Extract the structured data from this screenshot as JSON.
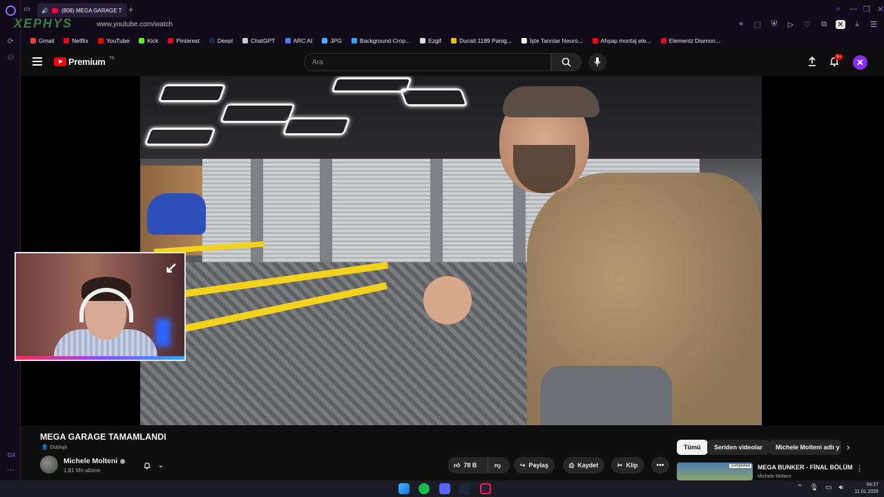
{
  "browser": {
    "tab_title": "(808) MEGA GARAGE T",
    "url": "www.youtube.com/watch",
    "brand_text": "XEPHYS",
    "gx_label": "GX",
    "bookmarks": [
      {
        "label": "Gmail",
        "color": "#ea4335"
      },
      {
        "label": "Netflix",
        "color": "#e50914"
      },
      {
        "label": "YouTube",
        "color": "#ff0000"
      },
      {
        "label": "Kick",
        "color": "#53fc18"
      },
      {
        "label": "Pinterest",
        "color": "#e60023"
      },
      {
        "label": "Deepl",
        "color": "#0f2b46"
      },
      {
        "label": "ChatGPT",
        "color": "#cccccc"
      },
      {
        "label": "ARC AI",
        "color": "#4f7cff"
      },
      {
        "label": "JPG",
        "color": "#4ab0ff"
      },
      {
        "label": "Background Crop...",
        "color": "#2fa6ff"
      },
      {
        "label": "Ezgif",
        "color": "#dddddd"
      },
      {
        "label": "Ducati 1199 Panig...",
        "color": "#e8c300"
      },
      {
        "label": "İşte Tanrılar Neuro...",
        "color": "#ffffff"
      },
      {
        "label": "Ahşap montaj ele...",
        "color": "#ff0000"
      },
      {
        "label": "Elementz Diamon...",
        "color": "#e60023"
      }
    ]
  },
  "youtube": {
    "logo_text": "Premium",
    "region": "TR",
    "search_placeholder": "Ara",
    "notification_count": "9+",
    "avatar_letter": "✕"
  },
  "video": {
    "title": "MEGA GARAGE TAMAMLANDI",
    "dub_label": "Dublajlı",
    "channel_name": "Michele Molteni",
    "subscribers": "1,81 Mn abone",
    "likes": "78 B",
    "share_label": "Paylaş",
    "save_label": "Kaydet",
    "clip_label": "Klip"
  },
  "chips": [
    "Tümü",
    "Seriden videolar",
    "Michele Molteni adlı y"
  ],
  "recommendation": {
    "title": "MEGA BUNKER - FİNAL BÖLÜM",
    "channel": "Michele Molteni",
    "badge": "completed"
  },
  "taskbar": {
    "time": "04:27",
    "date": "11.01.2026"
  },
  "colors": {
    "accent_purple": "#8b2cf5",
    "yt_red": "#ff0000",
    "gx_frame": "#120c1a"
  }
}
